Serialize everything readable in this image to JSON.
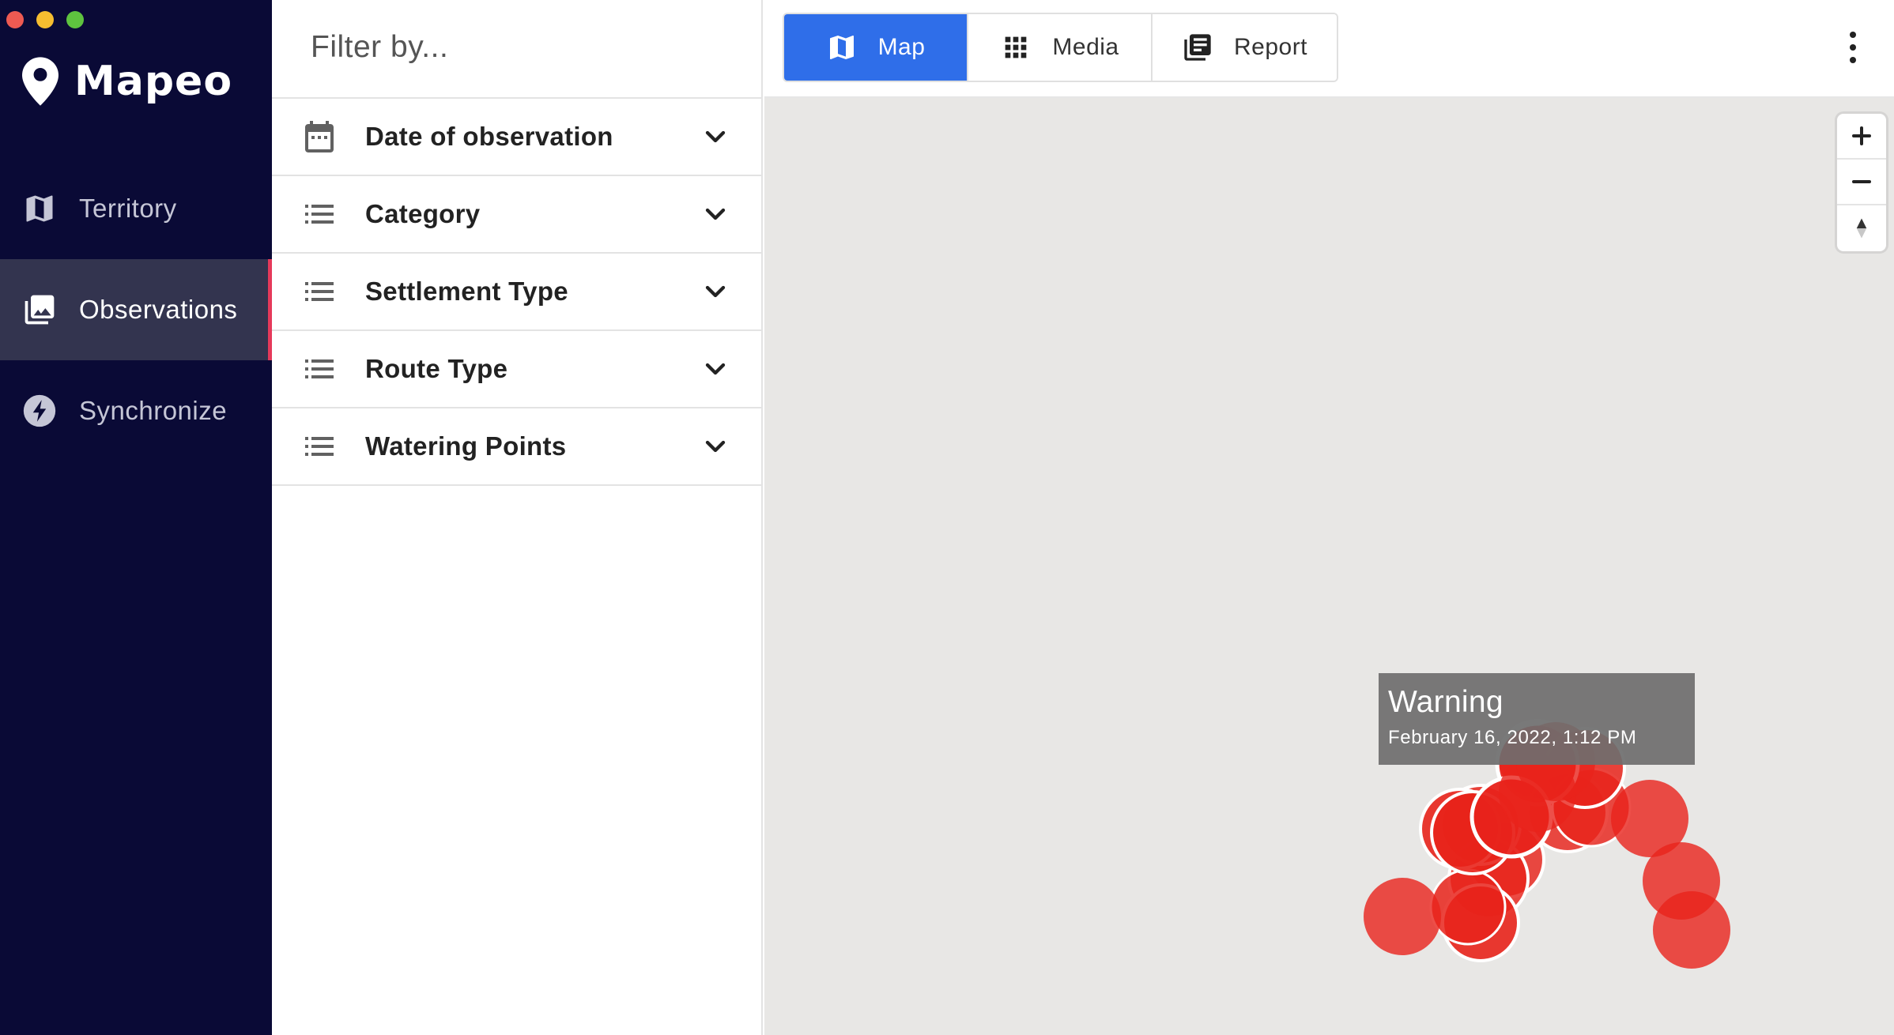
{
  "app": {
    "name": "Mapeo"
  },
  "window_controls": [
    "close",
    "minimize",
    "maximize"
  ],
  "sidebar": {
    "items": [
      {
        "label": "Territory",
        "icon": "map-icon",
        "active": false
      },
      {
        "label": "Observations",
        "icon": "photo-library-icon",
        "active": true
      },
      {
        "label": "Synchronize",
        "icon": "flash-icon",
        "active": false
      }
    ]
  },
  "filter": {
    "title": "Filter by...",
    "items": [
      {
        "label": "Date of observation",
        "icon": "calendar-icon"
      },
      {
        "label": "Category",
        "icon": "list-icon"
      },
      {
        "label": "Settlement Type",
        "icon": "list-icon"
      },
      {
        "label": "Route Type",
        "icon": "list-icon"
      },
      {
        "label": "Watering Points",
        "icon": "list-icon"
      }
    ]
  },
  "toolbar": {
    "tabs": [
      {
        "label": "Map",
        "icon": "map-icon",
        "active": true
      },
      {
        "label": "Media",
        "icon": "grid-icon",
        "active": false
      },
      {
        "label": "Report",
        "icon": "report-icon",
        "active": false
      }
    ],
    "menu_icon": "more-vert-icon"
  },
  "map": {
    "zoom_controls": [
      "zoom-in-icon",
      "zoom-out-icon",
      "compass-icon"
    ],
    "marker_color": "#e8231b",
    "popup": {
      "title": "Warning",
      "date": "February 16, 2022, 1:12 PM"
    }
  },
  "colors": {
    "sidebar_bg": "#0a0a36",
    "active_tab": "#2f6ee9",
    "active_indicator": "#e5395a",
    "map_bg": "#e8e7e5"
  }
}
